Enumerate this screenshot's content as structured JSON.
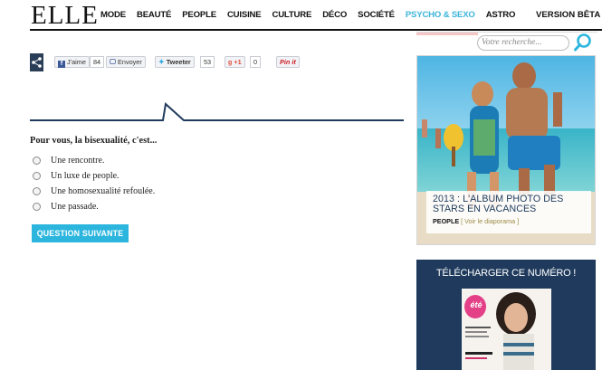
{
  "header": {
    "logo": "ELLE",
    "nav": [
      "MODE",
      "BEAUTÉ",
      "PEOPLE",
      "CUISINE",
      "CULTURE",
      "DÉCO",
      "SOCIÉTÉ",
      "PSYCHO & SEXO",
      "ASTRO"
    ],
    "active_nav": "PSYCHO & SEXO",
    "version": "VERSION BÊTA"
  },
  "search": {
    "placeholder": "Votre recherche..."
  },
  "share": {
    "like_label": "J'aime",
    "like_count": "84",
    "send_label": "Envoyer",
    "tweet_label": "Tweeter",
    "tweet_count": "53",
    "gplus_label": "+1",
    "gplus_count": "0",
    "pinit_label": "Pin it"
  },
  "poll": {
    "question": "Pour vous, la bisexualité, c'est...",
    "options": [
      "Une rencontre.",
      "Un luxe de people.",
      "Une homosexualité refoulée.",
      "Une passade."
    ],
    "next_label": "QUESTION SUIVANTE"
  },
  "promo": {
    "title_line1": "2013 : L'ALBUM PHOTO DES",
    "title_line2": "STARS EN VACANCES",
    "category": "PEOPLE",
    "link": "[ Voir le diaporama ]"
  },
  "magazine": {
    "title": "TÉLÉCHARGER CE NUMÉRO !",
    "cover_badge": "été"
  },
  "colors": {
    "accent": "#2cb6de",
    "navy": "#1f3a5c",
    "text": "#222222"
  }
}
